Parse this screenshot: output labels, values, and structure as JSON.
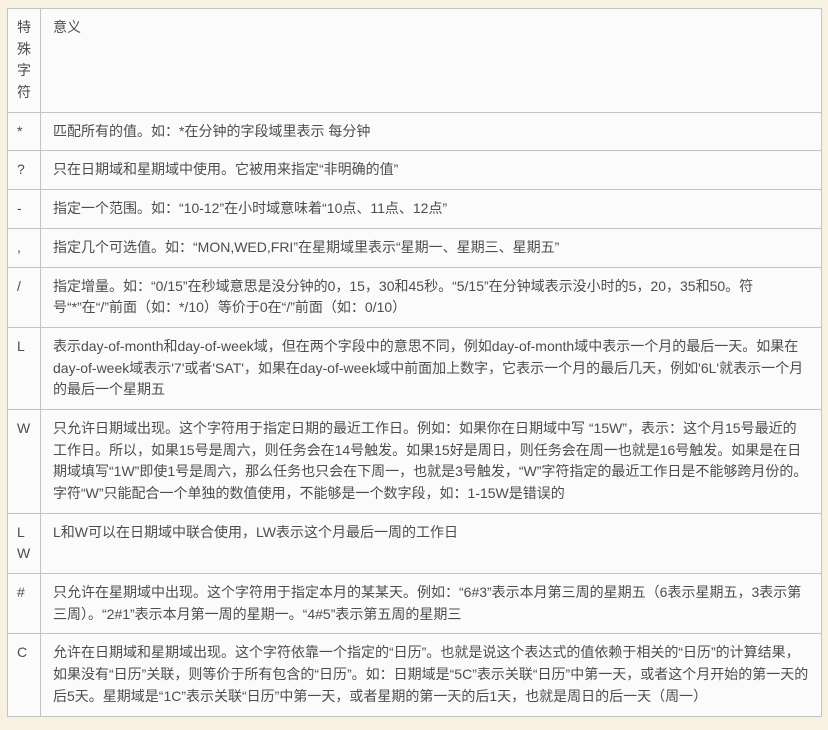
{
  "page": {
    "background_color": "#f8f1e1",
    "cell_background_color": "#fbfbfb",
    "border_color": "#c3c3c3",
    "text_color": "#4d4d4d"
  },
  "table": {
    "headers": {
      "char": "特殊字符",
      "meaning": "意义"
    },
    "rows": [
      {
        "char": "*",
        "meaning": "匹配所有的值。如：*在分钟的字段域里表示 每分钟"
      },
      {
        "char": "?",
        "meaning": "只在日期域和星期域中使用。它被用来指定“非明确的值”"
      },
      {
        "char": "-",
        "meaning": "指定一个范围。如：“10-12”在小时域意味着“10点、11点、12点”"
      },
      {
        "char": ",",
        "meaning": "指定几个可选值。如：“MON,WED,FRI”在星期域里表示“星期一、星期三、星期五”"
      },
      {
        "char": "/",
        "meaning": "指定增量。如：“0/15”在秒域意思是没分钟的0，15，30和45秒。“5/15”在分钟域表示没小时的5，20，35和50。符号“*”在“/”前面（如：*/10）等价于0在“/”前面（如：0/10）"
      },
      {
        "char": "L",
        "meaning": "表示day-of-month和day-of-week域，但在两个字段中的意思不同，例如day-of-month域中表示一个月的最后一天。如果在day-of-week域表示'7'或者'SAT'，如果在day-of-week域中前面加上数字，它表示一个月的最后几天，例如'6L'就表示一个月的最后一个星期五"
      },
      {
        "char": "W",
        "meaning": "只允许日期域出现。这个字符用于指定日期的最近工作日。例如：如果你在日期域中写 “15W”，表示：这个月15号最近的工作日。所以，如果15号是周六，则任务会在14号触发。如果15好是周日，则任务会在周一也就是16号触发。如果是在日期域填写“1W”即使1号是周六，那么任务也只会在下周一，也就是3号触发，“W”字符指定的最近工作日是不能够跨月份的。字符“W”只能配合一个单独的数值使用，不能够是一个数字段，如：1-15W是错误的"
      },
      {
        "char": "LW",
        "meaning": "L和W可以在日期域中联合使用，LW表示这个月最后一周的工作日"
      },
      {
        "char": "#",
        "meaning": "只允许在星期域中出现。这个字符用于指定本月的某某天。例如：“6#3”表示本月第三周的星期五（6表示星期五，3表示第三周）。“2#1”表示本月第一周的星期一。“4#5”表示第五周的星期三"
      },
      {
        "char": "C",
        "meaning": "允许在日期域和星期域出现。这个字符依靠一个指定的“日历”。也就是说这个表达式的值依赖于相关的“日历”的计算结果，如果没有“日历”关联，则等价于所有包含的“日历”。如：日期域是“5C”表示关联“日历”中第一天，或者这个月开始的第一天的后5天。星期域是“1C”表示关联“日历”中第一天，或者星期的第一天的后1天，也就是周日的后一天（周一）"
      }
    ]
  }
}
